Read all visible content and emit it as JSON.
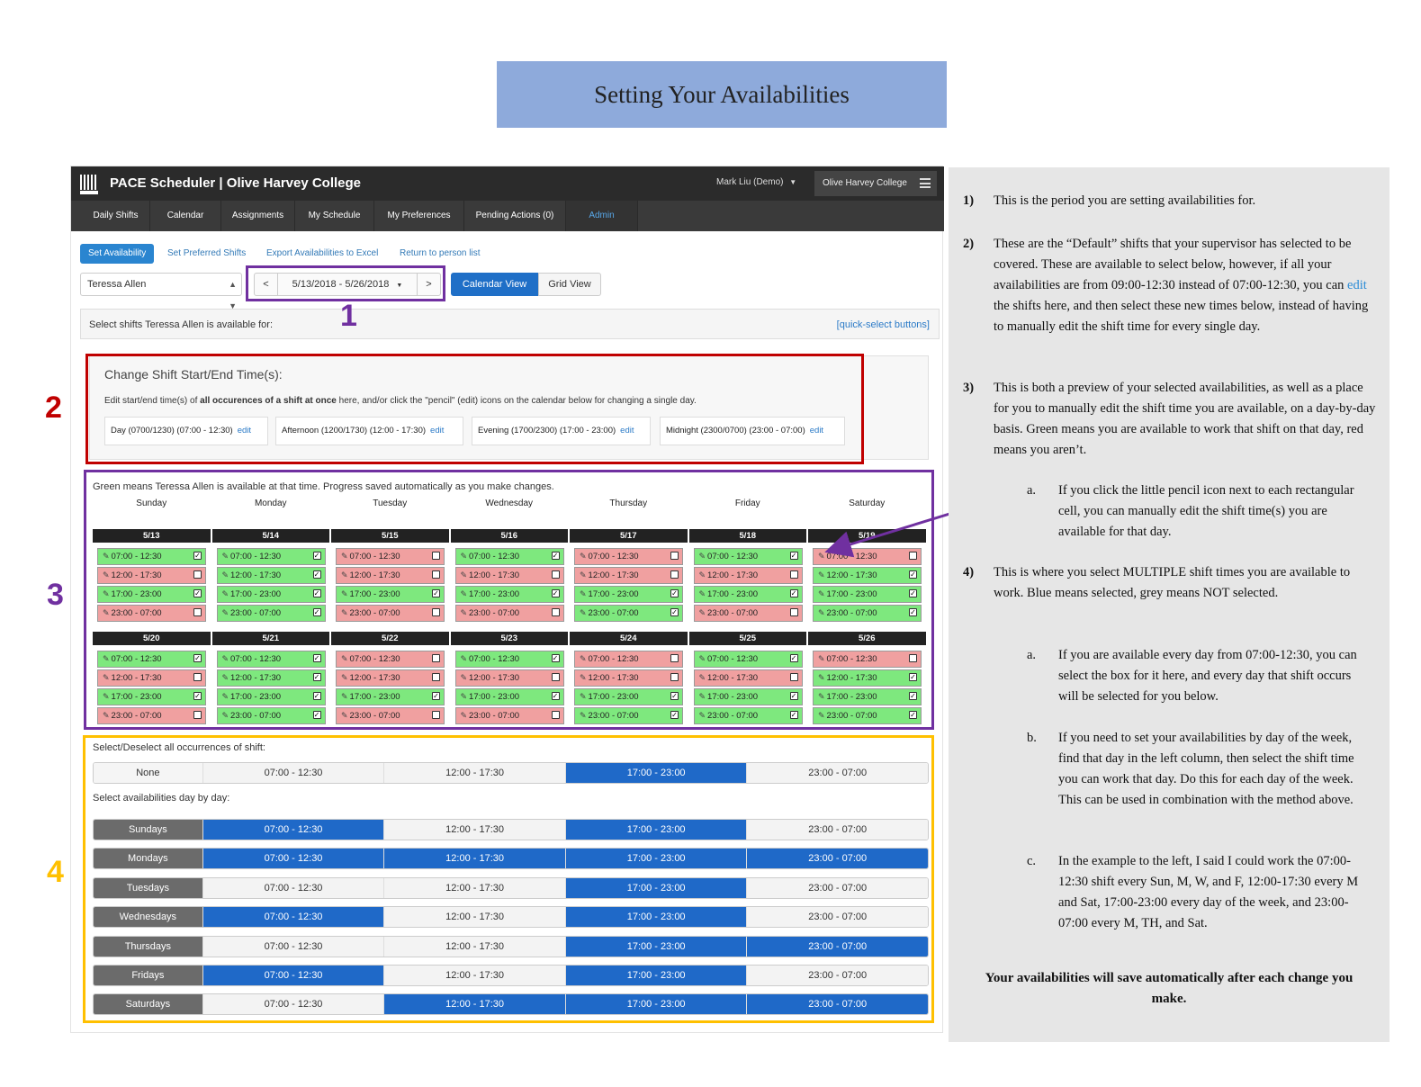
{
  "title": "Setting Your Availabilities",
  "app": {
    "name": "PACE Scheduler | Olive Harvey College",
    "logo_text": "PACE",
    "user": "Mark Liu (Demo)",
    "org": "Olive Harvey College",
    "nav": [
      "Daily Shifts",
      "Calendar",
      "Assignments",
      "My Schedule",
      "My Preferences",
      "Pending Actions (0)",
      "Admin"
    ],
    "actions": {
      "set_availability": "Set Availability",
      "set_preferred": "Set Preferred Shifts",
      "export": "Export Availabilities to Excel",
      "return": "Return to person list"
    },
    "person": "Teressa Allen",
    "date_range": "5/13/2018 - 5/26/2018",
    "prev": "<",
    "next": ">",
    "calendar_view": "Calendar View",
    "grid_view": "Grid View",
    "select_header": "Select shifts Teressa Allen is available for:",
    "quick_select": "[quick-select buttons]",
    "edit_title": "Change Shift Start/End Time(s):",
    "edit_desc_pre": "Edit start/end time(s) of ",
    "edit_desc_bold": "all occurences of a shift at once",
    "edit_desc_post": " here, and/or click the \"pencil\" (edit) icons on the calendar below for changing a single day.",
    "shifts": [
      {
        "label": "Day (0700/1230) (07:00 - 12:30)",
        "edit": "edit"
      },
      {
        "label": "Afternoon (1200/1730) (12:00 - 17:30)",
        "edit": "edit"
      },
      {
        "label": "Evening (1700/2300) (17:00 - 23:00)",
        "edit": "edit"
      },
      {
        "label": "Midnight (2300/0700) (23:00 - 07:00)",
        "edit": "edit"
      }
    ],
    "calendar_note": "Green means Teressa Allen is available at that time. Progress saved automatically as you make changes.",
    "days": [
      "Sunday",
      "Monday",
      "Tuesday",
      "Wednesday",
      "Thursday",
      "Friday",
      "Saturday"
    ],
    "times": [
      "07:00 - 12:30",
      "12:00 - 17:30",
      "17:00 - 23:00",
      "23:00 - 07:00"
    ],
    "weeks": [
      {
        "dates": [
          "5/13",
          "5/14",
          "5/15",
          "5/16",
          "5/17",
          "5/18",
          "5/19"
        ],
        "avail": [
          [
            1,
            0,
            1,
            0
          ],
          [
            1,
            1,
            1,
            1
          ],
          [
            0,
            0,
            1,
            0
          ],
          [
            1,
            0,
            1,
            0
          ],
          [
            0,
            0,
            1,
            1
          ],
          [
            1,
            0,
            1,
            0
          ],
          [
            0,
            1,
            1,
            1
          ]
        ]
      },
      {
        "dates": [
          "5/20",
          "5/21",
          "5/22",
          "5/23",
          "5/24",
          "5/25",
          "5/26"
        ],
        "avail": [
          [
            1,
            0,
            1,
            0
          ],
          [
            1,
            1,
            1,
            1
          ],
          [
            0,
            0,
            1,
            0
          ],
          [
            1,
            0,
            1,
            0
          ],
          [
            0,
            0,
            1,
            1
          ],
          [
            1,
            0,
            1,
            1
          ],
          [
            0,
            1,
            1,
            1
          ]
        ]
      }
    ],
    "select_all_label": "Select/Deselect all occurrences of shift:",
    "none": "None",
    "all_selected": [
      0,
      0,
      1,
      0
    ],
    "day_by_day_label": "Select availabilities day by day:",
    "day_rows": [
      {
        "day": "Sundays",
        "sel": [
          1,
          0,
          1,
          0
        ]
      },
      {
        "day": "Mondays",
        "sel": [
          1,
          1,
          1,
          1
        ]
      },
      {
        "day": "Tuesdays",
        "sel": [
          0,
          0,
          1,
          0
        ]
      },
      {
        "day": "Wednesdays",
        "sel": [
          1,
          0,
          1,
          0
        ]
      },
      {
        "day": "Thursdays",
        "sel": [
          0,
          0,
          1,
          1
        ]
      },
      {
        "day": "Fridays",
        "sel": [
          1,
          0,
          1,
          0
        ]
      },
      {
        "day": "Saturdays",
        "sel": [
          0,
          1,
          1,
          1
        ]
      }
    ]
  },
  "annotations": {
    "labels": [
      "1",
      "2",
      "3",
      "4"
    ],
    "colors": {
      "one": "#7030a0",
      "two": "#c00000",
      "three": "#7030a0",
      "four": "#ffc000"
    }
  },
  "instructions": {
    "i1_mark": "1)",
    "i1": "This is the period you are setting availabilities for.",
    "i2_mark": "2)",
    "i2_a": "These are the “Default” shifts that your supervisor has selected to be covered. These are available to select below, however, if all your availabilities are from 09:00-12:30 instead of 07:00-12:30, you can ",
    "i2_link": "edit",
    "i2_b": " the shifts here, and then select these new times below, instead of having to manually edit the shift time for every single day.",
    "i3_mark": "3)",
    "i3": "This is both a preview of your selected availabilities, as well as a place for you to manually edit the shift time you are available, on a day-by-day basis. Green means you are available to work that shift on that day, red means you aren’t.",
    "i3a_mark": "a.",
    "i3a": "If you click the little pencil icon next to each rectangular cell, you can manually edit the shift time(s) you are available for that day.",
    "i4_mark": "4)",
    "i4": "This is where you select MULTIPLE shift times you are available to work. Blue means selected, grey means NOT selected.",
    "i4a_mark": "a.",
    "i4a": "If you are available every day from 07:00-12:30, you can select the box for it here, and every day that shift occurs will be selected for you below.",
    "i4b_mark": "b.",
    "i4b": "If you need to set your availabilities by day of the week, find that day in the left column, then select the shift time you can work that day. Do this for each day of the week. This can be used in combination with the method above.",
    "i4c_mark": "c.",
    "i4c": "In the example to the left, I said I could work the 07:00-12:30 shift every Sun, M, W, and F, 12:00-17:30 every M and Sat, 17:00-23:00 every day of the week, and 23:00-07:00 every M, TH, and Sat.",
    "footer": "Your availabilities will save automatically after each change you make."
  }
}
